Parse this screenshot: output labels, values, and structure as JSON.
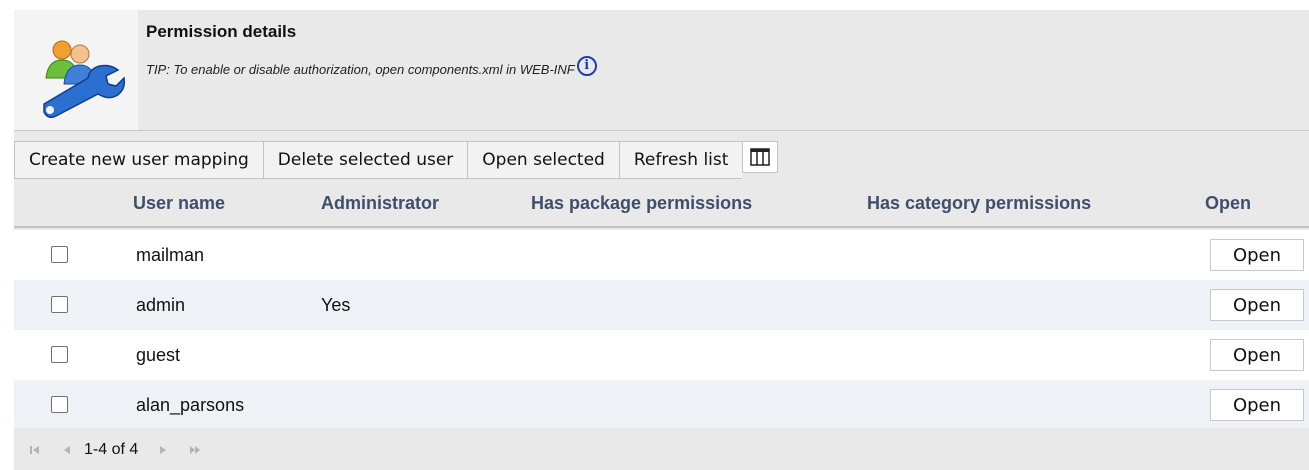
{
  "header": {
    "title": "Permission details",
    "tip": "TIP: To enable or disable authorization, open components.xml in WEB-INF",
    "info_glyph": "i",
    "icon": "users-wrench-icon"
  },
  "toolbar": {
    "create_label": "Create new user mapping",
    "delete_label": "Delete selected user",
    "open_label": "Open selected",
    "refresh_label": "Refresh list",
    "columns_icon": "columns-icon"
  },
  "table": {
    "columns": [
      "User name",
      "Administrator",
      "Has package permissions",
      "Has category permissions",
      "Open"
    ],
    "rows": [
      {
        "user": "mailman",
        "admin": "",
        "package": "",
        "category": "",
        "open": "Open"
      },
      {
        "user": "admin",
        "admin": "Yes",
        "package": "",
        "category": "",
        "open": "Open"
      },
      {
        "user": "guest",
        "admin": "",
        "package": "",
        "category": "",
        "open": "Open"
      },
      {
        "user": "alan_parsons",
        "admin": "",
        "package": "",
        "category": "",
        "open": "Open"
      }
    ]
  },
  "pager": {
    "range": "1-4 of 4"
  },
  "colors": {
    "header_bg": "#e9e9e9",
    "column_header_text": "#3f4f6b",
    "alt_row": "#eef2f7",
    "info_blue": "#1f3fa8"
  }
}
